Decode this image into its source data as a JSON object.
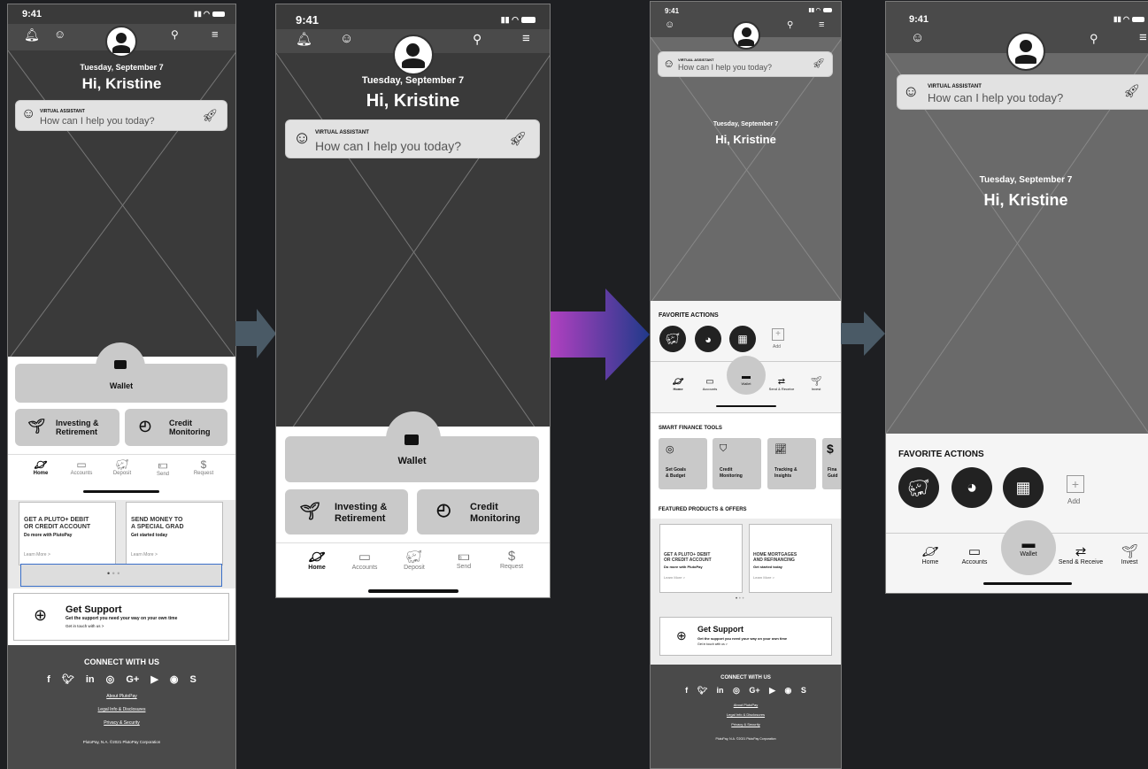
{
  "status": {
    "time": "9:41"
  },
  "greeting": {
    "date": "Tuesday, September 7",
    "hello": "Hi, Kristine"
  },
  "assistant": {
    "label": "VIRTUAL ASSISTANT",
    "prompt": "How can I help you today?"
  },
  "cards": {
    "wallet": "Wallet",
    "investing": "Investing &\nRetirement",
    "investing_l1": "Investing &",
    "investing_l2": "Retirement",
    "credit_l1": "Credit",
    "credit_l2": "Monitoring"
  },
  "tabs": [
    "Home",
    "Accounts",
    "Deposit",
    "Send",
    "Request"
  ],
  "promos": [
    {
      "title_l1": "GET A PLUTO+ DEBIT",
      "title_l2": "OR CREDIT ACCOUNT",
      "sub": "Do more with PlutoPay",
      "link": "Learn More >"
    },
    {
      "title_l1": "SEND MONEY TO",
      "title_l2": "A SPECIAL GRAD",
      "sub": "Get started today",
      "link": "Learn More >"
    },
    {
      "title_l1": "HOME MORTGAGES",
      "title_l2": "AND REFINANCING",
      "sub": "Get started today",
      "link": "Learn More >"
    }
  ],
  "support": {
    "title": "Get Support",
    "sub": "Get the support you need your way on your own time",
    "link": "Get in touch with us >"
  },
  "footer": {
    "connect": "CONNECT WITH US",
    "social": [
      "f",
      "t",
      "in",
      "ig",
      "G+",
      "yt",
      "wa",
      "sk"
    ],
    "links": [
      "About PlutoPay",
      "Legal Info & Disclosures",
      "Privacy & Security"
    ],
    "copyright": "PlutoPay, N.A. ©2021 PlutoPay Corporation"
  },
  "favorite": {
    "title": "FAVORITE ACTIONS",
    "add": "Add",
    "tabs": [
      "Home",
      "Accounts",
      "Wallet",
      "Send & Receive",
      "Invest"
    ]
  },
  "smart": {
    "title": "SMART FINANCE TOOLS",
    "items": [
      {
        "l1": "Set Goals",
        "l2": "& Budget"
      },
      {
        "l1": "Credit",
        "l2": "Monitoring"
      },
      {
        "l1": "Tracking &",
        "l2": "Insights"
      },
      {
        "l1": "Fina",
        "l2": "Guid"
      }
    ]
  },
  "featured": {
    "title": "FEATURED PRODUCTS & OFFERS"
  },
  "colors": {
    "dark": "#3a3a3a",
    "bg": "#1e1f22",
    "arrow_start": "#b040c0",
    "arrow_end": "#203a8a",
    "arrow_gray": "#4a5a66"
  }
}
